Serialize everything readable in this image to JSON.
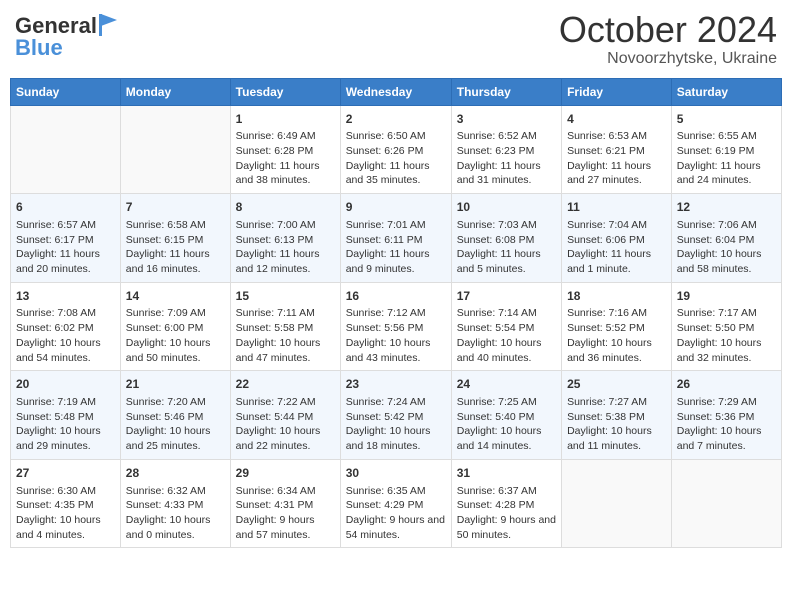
{
  "logo": {
    "text_general": "General",
    "text_blue": "Blue"
  },
  "title": {
    "month": "October 2024",
    "location": "Novoorzhytske, Ukraine"
  },
  "headers": [
    "Sunday",
    "Monday",
    "Tuesday",
    "Wednesday",
    "Thursday",
    "Friday",
    "Saturday"
  ],
  "weeks": [
    [
      {
        "day": "",
        "sunrise": "",
        "sunset": "",
        "daylight": ""
      },
      {
        "day": "",
        "sunrise": "",
        "sunset": "",
        "daylight": ""
      },
      {
        "day": "1",
        "sunrise": "Sunrise: 6:49 AM",
        "sunset": "Sunset: 6:28 PM",
        "daylight": "Daylight: 11 hours and 38 minutes."
      },
      {
        "day": "2",
        "sunrise": "Sunrise: 6:50 AM",
        "sunset": "Sunset: 6:26 PM",
        "daylight": "Daylight: 11 hours and 35 minutes."
      },
      {
        "day": "3",
        "sunrise": "Sunrise: 6:52 AM",
        "sunset": "Sunset: 6:23 PM",
        "daylight": "Daylight: 11 hours and 31 minutes."
      },
      {
        "day": "4",
        "sunrise": "Sunrise: 6:53 AM",
        "sunset": "Sunset: 6:21 PM",
        "daylight": "Daylight: 11 hours and 27 minutes."
      },
      {
        "day": "5",
        "sunrise": "Sunrise: 6:55 AM",
        "sunset": "Sunset: 6:19 PM",
        "daylight": "Daylight: 11 hours and 24 minutes."
      }
    ],
    [
      {
        "day": "6",
        "sunrise": "Sunrise: 6:57 AM",
        "sunset": "Sunset: 6:17 PM",
        "daylight": "Daylight: 11 hours and 20 minutes."
      },
      {
        "day": "7",
        "sunrise": "Sunrise: 6:58 AM",
        "sunset": "Sunset: 6:15 PM",
        "daylight": "Daylight: 11 hours and 16 minutes."
      },
      {
        "day": "8",
        "sunrise": "Sunrise: 7:00 AM",
        "sunset": "Sunset: 6:13 PM",
        "daylight": "Daylight: 11 hours and 12 minutes."
      },
      {
        "day": "9",
        "sunrise": "Sunrise: 7:01 AM",
        "sunset": "Sunset: 6:11 PM",
        "daylight": "Daylight: 11 hours and 9 minutes."
      },
      {
        "day": "10",
        "sunrise": "Sunrise: 7:03 AM",
        "sunset": "Sunset: 6:08 PM",
        "daylight": "Daylight: 11 hours and 5 minutes."
      },
      {
        "day": "11",
        "sunrise": "Sunrise: 7:04 AM",
        "sunset": "Sunset: 6:06 PM",
        "daylight": "Daylight: 11 hours and 1 minute."
      },
      {
        "day": "12",
        "sunrise": "Sunrise: 7:06 AM",
        "sunset": "Sunset: 6:04 PM",
        "daylight": "Daylight: 10 hours and 58 minutes."
      }
    ],
    [
      {
        "day": "13",
        "sunrise": "Sunrise: 7:08 AM",
        "sunset": "Sunset: 6:02 PM",
        "daylight": "Daylight: 10 hours and 54 minutes."
      },
      {
        "day": "14",
        "sunrise": "Sunrise: 7:09 AM",
        "sunset": "Sunset: 6:00 PM",
        "daylight": "Daylight: 10 hours and 50 minutes."
      },
      {
        "day": "15",
        "sunrise": "Sunrise: 7:11 AM",
        "sunset": "Sunset: 5:58 PM",
        "daylight": "Daylight: 10 hours and 47 minutes."
      },
      {
        "day": "16",
        "sunrise": "Sunrise: 7:12 AM",
        "sunset": "Sunset: 5:56 PM",
        "daylight": "Daylight: 10 hours and 43 minutes."
      },
      {
        "day": "17",
        "sunrise": "Sunrise: 7:14 AM",
        "sunset": "Sunset: 5:54 PM",
        "daylight": "Daylight: 10 hours and 40 minutes."
      },
      {
        "day": "18",
        "sunrise": "Sunrise: 7:16 AM",
        "sunset": "Sunset: 5:52 PM",
        "daylight": "Daylight: 10 hours and 36 minutes."
      },
      {
        "day": "19",
        "sunrise": "Sunrise: 7:17 AM",
        "sunset": "Sunset: 5:50 PM",
        "daylight": "Daylight: 10 hours and 32 minutes."
      }
    ],
    [
      {
        "day": "20",
        "sunrise": "Sunrise: 7:19 AM",
        "sunset": "Sunset: 5:48 PM",
        "daylight": "Daylight: 10 hours and 29 minutes."
      },
      {
        "day": "21",
        "sunrise": "Sunrise: 7:20 AM",
        "sunset": "Sunset: 5:46 PM",
        "daylight": "Daylight: 10 hours and 25 minutes."
      },
      {
        "day": "22",
        "sunrise": "Sunrise: 7:22 AM",
        "sunset": "Sunset: 5:44 PM",
        "daylight": "Daylight: 10 hours and 22 minutes."
      },
      {
        "day": "23",
        "sunrise": "Sunrise: 7:24 AM",
        "sunset": "Sunset: 5:42 PM",
        "daylight": "Daylight: 10 hours and 18 minutes."
      },
      {
        "day": "24",
        "sunrise": "Sunrise: 7:25 AM",
        "sunset": "Sunset: 5:40 PM",
        "daylight": "Daylight: 10 hours and 14 minutes."
      },
      {
        "day": "25",
        "sunrise": "Sunrise: 7:27 AM",
        "sunset": "Sunset: 5:38 PM",
        "daylight": "Daylight: 10 hours and 11 minutes."
      },
      {
        "day": "26",
        "sunrise": "Sunrise: 7:29 AM",
        "sunset": "Sunset: 5:36 PM",
        "daylight": "Daylight: 10 hours and 7 minutes."
      }
    ],
    [
      {
        "day": "27",
        "sunrise": "Sunrise: 6:30 AM",
        "sunset": "Sunset: 4:35 PM",
        "daylight": "Daylight: 10 hours and 4 minutes."
      },
      {
        "day": "28",
        "sunrise": "Sunrise: 6:32 AM",
        "sunset": "Sunset: 4:33 PM",
        "daylight": "Daylight: 10 hours and 0 minutes."
      },
      {
        "day": "29",
        "sunrise": "Sunrise: 6:34 AM",
        "sunset": "Sunset: 4:31 PM",
        "daylight": "Daylight: 9 hours and 57 minutes."
      },
      {
        "day": "30",
        "sunrise": "Sunrise: 6:35 AM",
        "sunset": "Sunset: 4:29 PM",
        "daylight": "Daylight: 9 hours and 54 minutes."
      },
      {
        "day": "31",
        "sunrise": "Sunrise: 6:37 AM",
        "sunset": "Sunset: 4:28 PM",
        "daylight": "Daylight: 9 hours and 50 minutes."
      },
      {
        "day": "",
        "sunrise": "",
        "sunset": "",
        "daylight": ""
      },
      {
        "day": "",
        "sunrise": "",
        "sunset": "",
        "daylight": ""
      }
    ]
  ]
}
